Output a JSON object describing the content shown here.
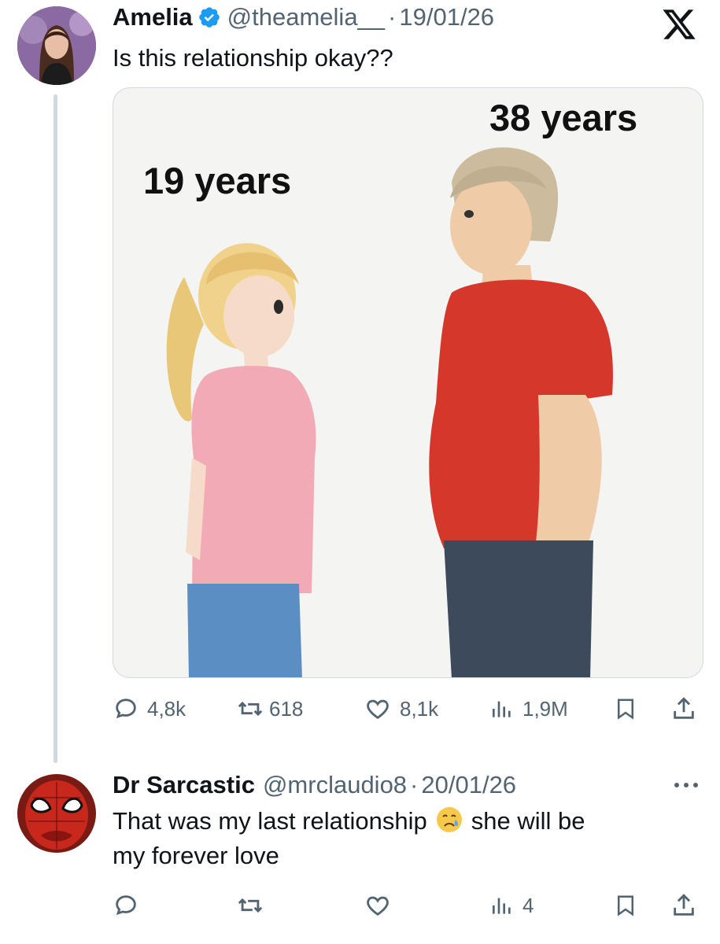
{
  "tweet": {
    "author_name": "Amelia",
    "handle": "@theamelia__",
    "separator": "·",
    "date": "19/01/26",
    "text": "Is this relationship okay??",
    "image": {
      "left_label": "19 years",
      "right_label": "38 years"
    },
    "actions": {
      "replies": "4,8k",
      "reposts": "618",
      "likes": "8,1k",
      "views": "1,9M"
    }
  },
  "reply": {
    "author_name": "Dr Sarcastic",
    "handle": "@mrclaudio8",
    "separator": "·",
    "date": "20/01/26",
    "text_part1": "That was my last relationship",
    "text_part2": "she will be",
    "text_line2": "my forever love",
    "actions": {
      "views": "4"
    }
  },
  "colors": {
    "verified": "#1d9bf0",
    "muted": "#536471",
    "text": "#0f1419",
    "thread_line": "#cfd9de"
  },
  "icons": [
    "x-logo-icon",
    "verified-badge-icon",
    "reply-icon",
    "repost-icon",
    "like-icon",
    "views-icon",
    "bookmark-icon",
    "share-icon",
    "more-icon",
    "crying-face-emoji"
  ]
}
